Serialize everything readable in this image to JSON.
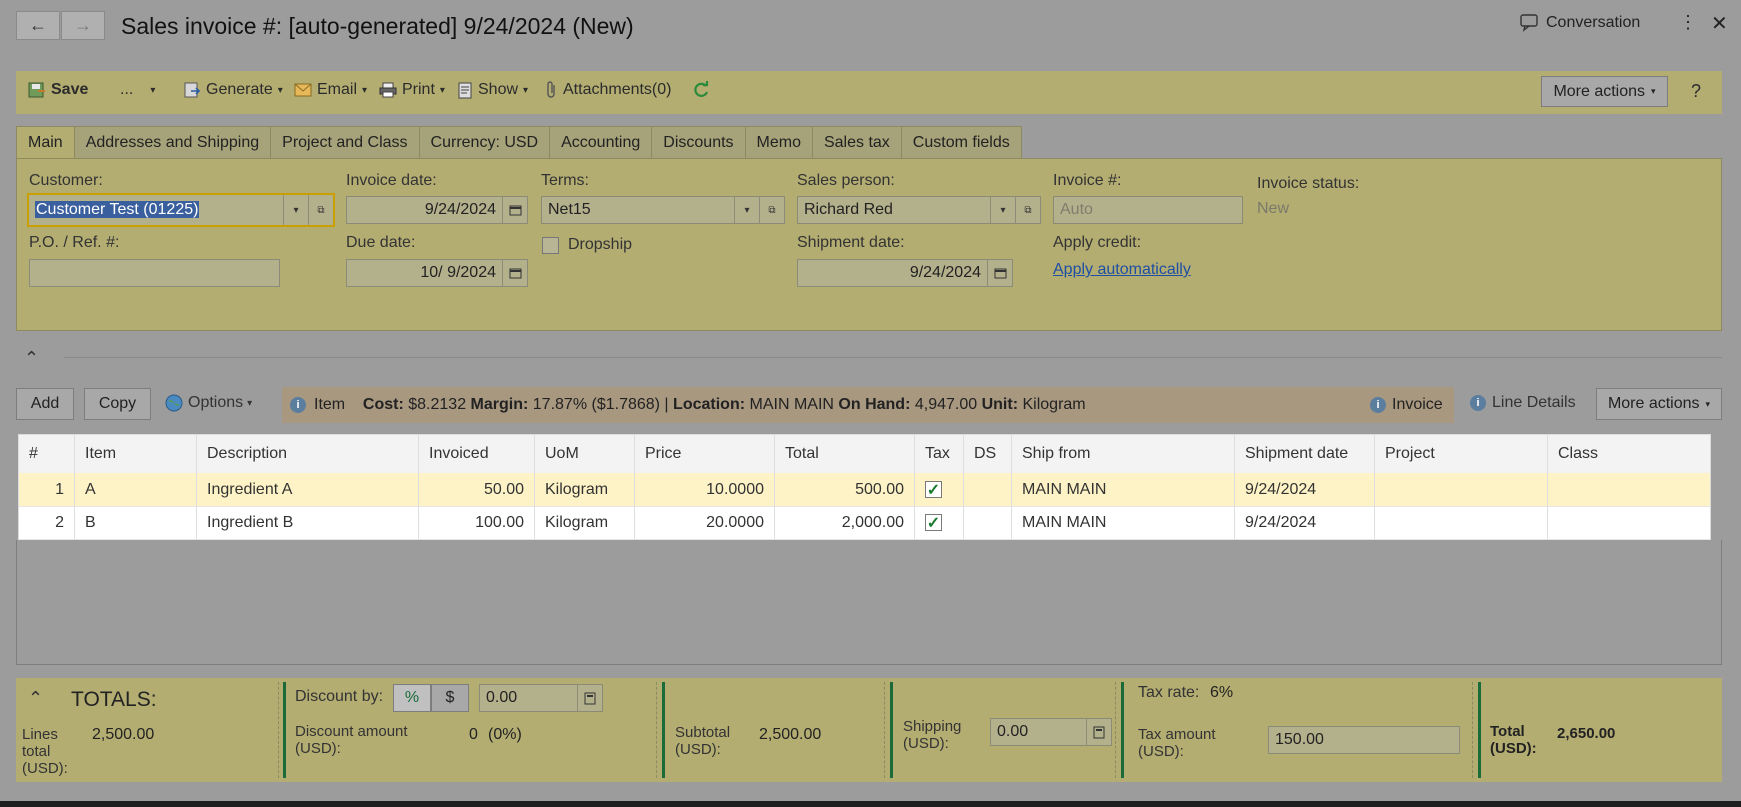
{
  "window": {
    "title": "Sales invoice #: [auto-generated] 9/24/2024 (New)",
    "conversation_label": "Conversation"
  },
  "toolbar": {
    "save": "Save",
    "more_dots": "...",
    "generate": "Generate",
    "email": "Email",
    "print": "Print",
    "show": "Show",
    "attachments": "Attachments(0)",
    "more_actions": "More actions",
    "help": "?"
  },
  "tabs": [
    "Main",
    "Addresses and Shipping",
    "Project and Class",
    "Currency: USD",
    "Accounting",
    "Discounts",
    "Memo",
    "Sales tax",
    "Custom fields"
  ],
  "form": {
    "customer_label": "Customer:",
    "customer_value": "Customer Test (01225)",
    "po_label": "P.O. / Ref. #:",
    "po_value": "",
    "invoice_date_label": "Invoice date:",
    "invoice_date_value": "9/24/2024",
    "due_date_label": "Due date:",
    "due_date_value": "10/ 9/2024",
    "terms_label": "Terms:",
    "terms_value": "Net15",
    "dropship_label": "Dropship",
    "sales_person_label": "Sales person:",
    "sales_person_value": "Richard Red",
    "shipment_date_label": "Shipment date:",
    "shipment_date_value": "9/24/2024",
    "invoice_no_label": "Invoice #:",
    "invoice_no_placeholder": "Auto",
    "apply_credit_label": "Apply credit:",
    "apply_credit_link": "Apply automatically",
    "invoice_status_label": "Invoice status:",
    "invoice_status_value": "New"
  },
  "lines_toolbar": {
    "add": "Add",
    "copy": "Copy",
    "options": "Options",
    "item_label": "Item",
    "cost_label": "Cost:",
    "cost_value": "$8.2132",
    "margin_label": "Margin:",
    "margin_value": "17.87% ($1.7868) |",
    "location_label": "Location:",
    "location_value": "MAIN MAIN",
    "onhand_label": "On Hand:",
    "onhand_value": "4,947.00",
    "unit_label": "Unit:",
    "unit_value": "Kilogram",
    "invoice": "Invoice",
    "line_details": "Line Details",
    "more_actions": "More actions"
  },
  "grid": {
    "columns": [
      "#",
      "Item",
      "Description",
      "Invoiced",
      "UoM",
      "Price",
      "Total",
      "Tax",
      "DS",
      "Ship from",
      "Shipment date",
      "Project",
      "Class"
    ],
    "rows": [
      {
        "num": "1",
        "item": "A",
        "description": "Ingredient A",
        "invoiced": "50.00",
        "uom": "Kilogram",
        "price": "10.0000",
        "total": "500.00",
        "tax": true,
        "ds": "",
        "ship_from": "MAIN MAIN",
        "shipment_date": "9/24/2024",
        "project": "",
        "class": ""
      },
      {
        "num": "2",
        "item": "B",
        "description": "Ingredient B",
        "invoiced": "100.00",
        "uom": "Kilogram",
        "price": "20.0000",
        "total": "2,000.00",
        "tax": true,
        "ds": "",
        "ship_from": "MAIN MAIN",
        "shipment_date": "9/24/2024",
        "project": "",
        "class": ""
      }
    ]
  },
  "totals": {
    "title": "TOTALS:",
    "lines_total_label": "Lines total (USD):",
    "lines_total_value": "2,500.00",
    "discount_by_label": "Discount by:",
    "discount_pct": "%",
    "discount_usd": "$",
    "discount_value": "0.00",
    "discount_amount_label": "Discount amount (USD):",
    "discount_amount_value": "0",
    "discount_amount_pct": "(0%)",
    "subtotal_label": "Subtotal (USD):",
    "subtotal_value": "2,500.00",
    "shipping_label": "Shipping (USD):",
    "shipping_value": "0.00",
    "tax_rate_label": "Tax rate:",
    "tax_rate_value": "6%",
    "tax_amount_label": "Tax amount (USD):",
    "tax_amount_value": "150.00",
    "total_label": "Total (USD):",
    "total_value": "2,650.00"
  },
  "colors": {
    "accent_yellow": "#b3ad72",
    "selected_row": "#fdf3c6",
    "green_bar": "#1a6a3a",
    "link": "#1f4fa3"
  }
}
